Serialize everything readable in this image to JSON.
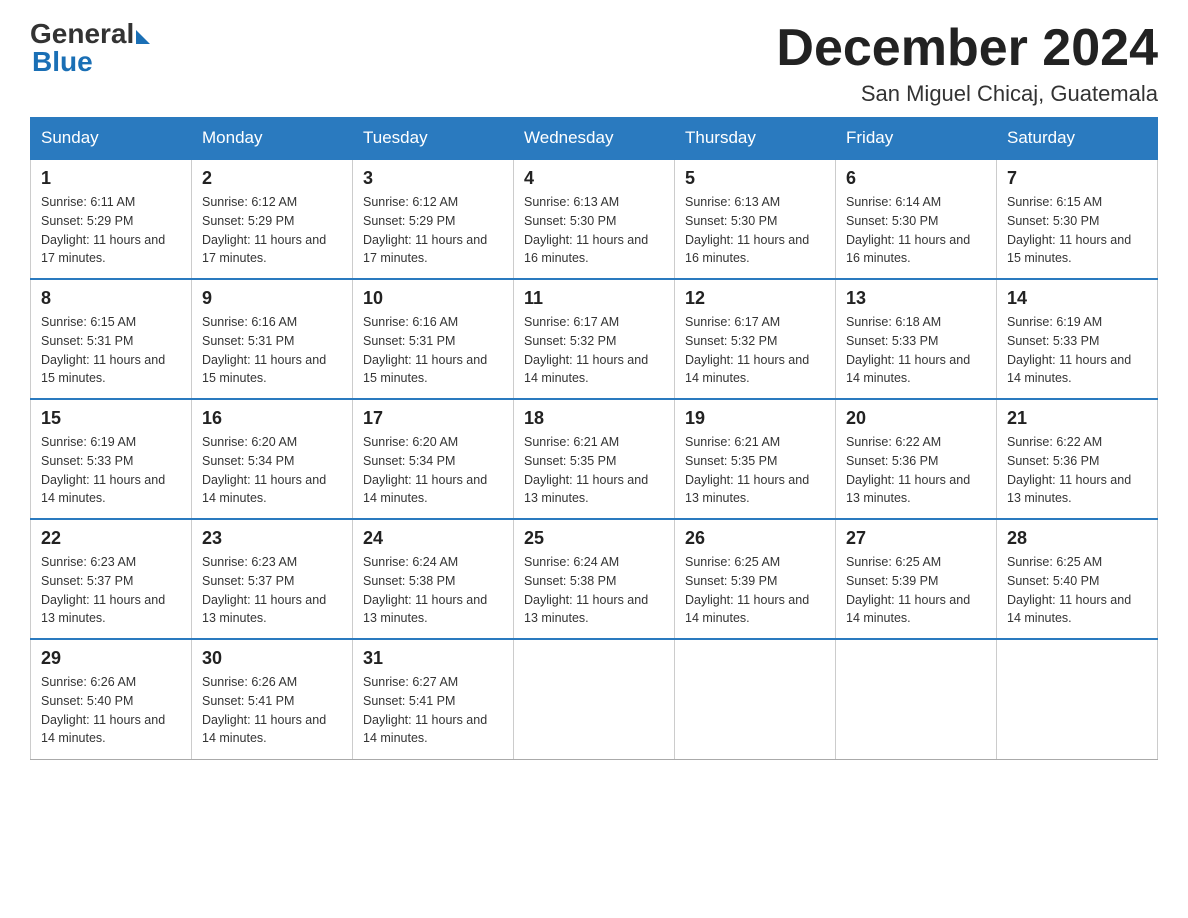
{
  "header": {
    "month_title": "December 2024",
    "location": "San Miguel Chicaj, Guatemala",
    "logo_general": "General",
    "logo_blue": "Blue"
  },
  "days_of_week": [
    "Sunday",
    "Monday",
    "Tuesday",
    "Wednesday",
    "Thursday",
    "Friday",
    "Saturday"
  ],
  "weeks": [
    [
      {
        "day": "1",
        "sunrise": "6:11 AM",
        "sunset": "5:29 PM",
        "daylight": "11 hours and 17 minutes."
      },
      {
        "day": "2",
        "sunrise": "6:12 AM",
        "sunset": "5:29 PM",
        "daylight": "11 hours and 17 minutes."
      },
      {
        "day": "3",
        "sunrise": "6:12 AM",
        "sunset": "5:29 PM",
        "daylight": "11 hours and 17 minutes."
      },
      {
        "day": "4",
        "sunrise": "6:13 AM",
        "sunset": "5:30 PM",
        "daylight": "11 hours and 16 minutes."
      },
      {
        "day": "5",
        "sunrise": "6:13 AM",
        "sunset": "5:30 PM",
        "daylight": "11 hours and 16 minutes."
      },
      {
        "day": "6",
        "sunrise": "6:14 AM",
        "sunset": "5:30 PM",
        "daylight": "11 hours and 16 minutes."
      },
      {
        "day": "7",
        "sunrise": "6:15 AM",
        "sunset": "5:30 PM",
        "daylight": "11 hours and 15 minutes."
      }
    ],
    [
      {
        "day": "8",
        "sunrise": "6:15 AM",
        "sunset": "5:31 PM",
        "daylight": "11 hours and 15 minutes."
      },
      {
        "day": "9",
        "sunrise": "6:16 AM",
        "sunset": "5:31 PM",
        "daylight": "11 hours and 15 minutes."
      },
      {
        "day": "10",
        "sunrise": "6:16 AM",
        "sunset": "5:31 PM",
        "daylight": "11 hours and 15 minutes."
      },
      {
        "day": "11",
        "sunrise": "6:17 AM",
        "sunset": "5:32 PM",
        "daylight": "11 hours and 14 minutes."
      },
      {
        "day": "12",
        "sunrise": "6:17 AM",
        "sunset": "5:32 PM",
        "daylight": "11 hours and 14 minutes."
      },
      {
        "day": "13",
        "sunrise": "6:18 AM",
        "sunset": "5:33 PM",
        "daylight": "11 hours and 14 minutes."
      },
      {
        "day": "14",
        "sunrise": "6:19 AM",
        "sunset": "5:33 PM",
        "daylight": "11 hours and 14 minutes."
      }
    ],
    [
      {
        "day": "15",
        "sunrise": "6:19 AM",
        "sunset": "5:33 PM",
        "daylight": "11 hours and 14 minutes."
      },
      {
        "day": "16",
        "sunrise": "6:20 AM",
        "sunset": "5:34 PM",
        "daylight": "11 hours and 14 minutes."
      },
      {
        "day": "17",
        "sunrise": "6:20 AM",
        "sunset": "5:34 PM",
        "daylight": "11 hours and 14 minutes."
      },
      {
        "day": "18",
        "sunrise": "6:21 AM",
        "sunset": "5:35 PM",
        "daylight": "11 hours and 13 minutes."
      },
      {
        "day": "19",
        "sunrise": "6:21 AM",
        "sunset": "5:35 PM",
        "daylight": "11 hours and 13 minutes."
      },
      {
        "day": "20",
        "sunrise": "6:22 AM",
        "sunset": "5:36 PM",
        "daylight": "11 hours and 13 minutes."
      },
      {
        "day": "21",
        "sunrise": "6:22 AM",
        "sunset": "5:36 PM",
        "daylight": "11 hours and 13 minutes."
      }
    ],
    [
      {
        "day": "22",
        "sunrise": "6:23 AM",
        "sunset": "5:37 PM",
        "daylight": "11 hours and 13 minutes."
      },
      {
        "day": "23",
        "sunrise": "6:23 AM",
        "sunset": "5:37 PM",
        "daylight": "11 hours and 13 minutes."
      },
      {
        "day": "24",
        "sunrise": "6:24 AM",
        "sunset": "5:38 PM",
        "daylight": "11 hours and 13 minutes."
      },
      {
        "day": "25",
        "sunrise": "6:24 AM",
        "sunset": "5:38 PM",
        "daylight": "11 hours and 13 minutes."
      },
      {
        "day": "26",
        "sunrise": "6:25 AM",
        "sunset": "5:39 PM",
        "daylight": "11 hours and 14 minutes."
      },
      {
        "day": "27",
        "sunrise": "6:25 AM",
        "sunset": "5:39 PM",
        "daylight": "11 hours and 14 minutes."
      },
      {
        "day": "28",
        "sunrise": "6:25 AM",
        "sunset": "5:40 PM",
        "daylight": "11 hours and 14 minutes."
      }
    ],
    [
      {
        "day": "29",
        "sunrise": "6:26 AM",
        "sunset": "5:40 PM",
        "daylight": "11 hours and 14 minutes."
      },
      {
        "day": "30",
        "sunrise": "6:26 AM",
        "sunset": "5:41 PM",
        "daylight": "11 hours and 14 minutes."
      },
      {
        "day": "31",
        "sunrise": "6:27 AM",
        "sunset": "5:41 PM",
        "daylight": "11 hours and 14 minutes."
      },
      null,
      null,
      null,
      null
    ]
  ],
  "labels": {
    "sunrise_prefix": "Sunrise: ",
    "sunset_prefix": "Sunset: ",
    "daylight_prefix": "Daylight: "
  }
}
